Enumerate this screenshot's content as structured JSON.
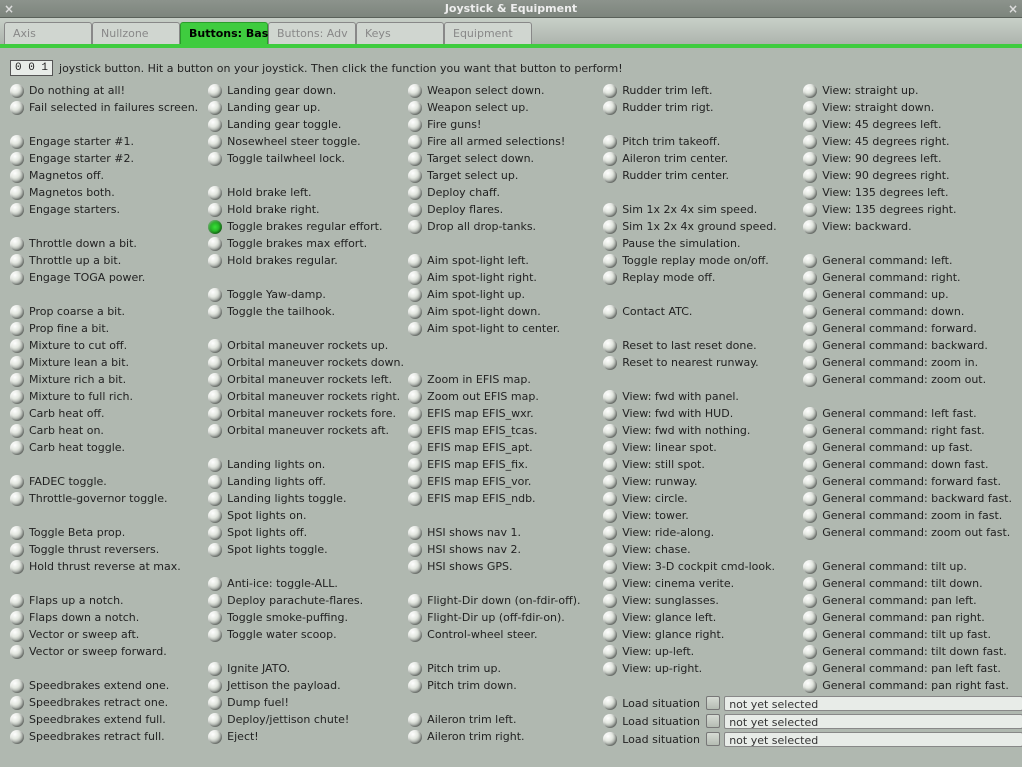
{
  "window": {
    "title": "Joystick & Equipment",
    "close_glyph": "×"
  },
  "tabs": [
    {
      "label": "Axis",
      "active": false
    },
    {
      "label": "Nullzone",
      "active": false
    },
    {
      "label": "Buttons: Basic",
      "active": true
    },
    {
      "label": "Buttons: Adv",
      "active": false
    },
    {
      "label": "Keys",
      "active": false
    },
    {
      "label": "Equipment",
      "active": false
    }
  ],
  "hint": {
    "value": "0 0 1",
    "text": "joystick button. Hit a button on your joystick. Then click the function you want that button to perform!"
  },
  "columns": [
    [
      {
        "t": "opt",
        "label": "Do nothing at all!"
      },
      {
        "t": "opt",
        "label": "Fail selected in failures screen."
      },
      {
        "t": "spacer"
      },
      {
        "t": "opt",
        "label": "Engage starter #1."
      },
      {
        "t": "opt",
        "label": "Engage starter #2."
      },
      {
        "t": "opt",
        "label": "Magnetos off."
      },
      {
        "t": "opt",
        "label": "Magnetos both."
      },
      {
        "t": "opt",
        "label": "Engage starters."
      },
      {
        "t": "spacer"
      },
      {
        "t": "opt",
        "label": "Throttle down a bit."
      },
      {
        "t": "opt",
        "label": "Throttle up a bit."
      },
      {
        "t": "opt",
        "label": "Engage TOGA power."
      },
      {
        "t": "spacer"
      },
      {
        "t": "opt",
        "label": "Prop coarse a bit."
      },
      {
        "t": "opt",
        "label": "Prop fine a bit."
      },
      {
        "t": "opt",
        "label": "Mixture to cut off."
      },
      {
        "t": "opt",
        "label": "Mixture lean a bit."
      },
      {
        "t": "opt",
        "label": "Mixture rich a bit."
      },
      {
        "t": "opt",
        "label": "Mixture to full rich."
      },
      {
        "t": "opt",
        "label": "Carb heat off."
      },
      {
        "t": "opt",
        "label": "Carb heat on."
      },
      {
        "t": "opt",
        "label": "Carb heat toggle."
      },
      {
        "t": "spacer"
      },
      {
        "t": "opt",
        "label": "FADEC toggle."
      },
      {
        "t": "opt",
        "label": "Throttle-governor toggle."
      },
      {
        "t": "spacer"
      },
      {
        "t": "opt",
        "label": "Toggle Beta prop."
      },
      {
        "t": "opt",
        "label": "Toggle thrust reversers."
      },
      {
        "t": "opt",
        "label": "Hold thrust reverse at max."
      },
      {
        "t": "spacer"
      },
      {
        "t": "opt",
        "label": "Flaps up a notch."
      },
      {
        "t": "opt",
        "label": "Flaps down a notch."
      },
      {
        "t": "opt",
        "label": "Vector or sweep aft."
      },
      {
        "t": "opt",
        "label": "Vector or sweep forward."
      },
      {
        "t": "spacer"
      },
      {
        "t": "opt",
        "label": "Speedbrakes extend one."
      },
      {
        "t": "opt",
        "label": "Speedbrakes retract one."
      },
      {
        "t": "opt",
        "label": "Speedbrakes extend full."
      },
      {
        "t": "opt",
        "label": "Speedbrakes retract full."
      }
    ],
    [
      {
        "t": "opt",
        "label": "Landing gear down."
      },
      {
        "t": "opt",
        "label": "Landing gear up."
      },
      {
        "t": "opt",
        "label": "Landing gear toggle."
      },
      {
        "t": "opt",
        "label": "Nosewheel steer toggle."
      },
      {
        "t": "opt",
        "label": "Toggle tailwheel lock."
      },
      {
        "t": "spacer"
      },
      {
        "t": "opt",
        "label": "Hold brake left."
      },
      {
        "t": "opt",
        "label": "Hold brake right."
      },
      {
        "t": "opt",
        "label": "Toggle brakes regular effort.",
        "checked": true
      },
      {
        "t": "opt",
        "label": "Toggle brakes max effort."
      },
      {
        "t": "opt",
        "label": "Hold brakes regular."
      },
      {
        "t": "spacer"
      },
      {
        "t": "opt",
        "label": "Toggle Yaw-damp."
      },
      {
        "t": "opt",
        "label": "Toggle the tailhook."
      },
      {
        "t": "spacer"
      },
      {
        "t": "opt",
        "label": "Orbital maneuver rockets up."
      },
      {
        "t": "opt",
        "label": "Orbital maneuver rockets down."
      },
      {
        "t": "opt",
        "label": "Orbital maneuver rockets left."
      },
      {
        "t": "opt",
        "label": "Orbital maneuver rockets right."
      },
      {
        "t": "opt",
        "label": "Orbital maneuver rockets fore."
      },
      {
        "t": "opt",
        "label": "Orbital maneuver rockets aft."
      },
      {
        "t": "spacer"
      },
      {
        "t": "opt",
        "label": "Landing lights on."
      },
      {
        "t": "opt",
        "label": "Landing lights off."
      },
      {
        "t": "opt",
        "label": "Landing lights toggle."
      },
      {
        "t": "opt",
        "label": "Spot lights on."
      },
      {
        "t": "opt",
        "label": "Spot lights off."
      },
      {
        "t": "opt",
        "label": "Spot lights toggle."
      },
      {
        "t": "spacer"
      },
      {
        "t": "opt",
        "label": "Anti-ice: toggle-ALL."
      },
      {
        "t": "opt",
        "label": "Deploy parachute-flares."
      },
      {
        "t": "opt",
        "label": "Toggle smoke-puffing."
      },
      {
        "t": "opt",
        "label": "Toggle water scoop."
      },
      {
        "t": "spacer"
      },
      {
        "t": "opt",
        "label": "Ignite JATO."
      },
      {
        "t": "opt",
        "label": "Jettison the payload."
      },
      {
        "t": "opt",
        "label": "Dump fuel!"
      },
      {
        "t": "opt",
        "label": "Deploy/jettison chute!"
      },
      {
        "t": "opt",
        "label": "Eject!"
      }
    ],
    [
      {
        "t": "opt",
        "label": "Weapon select down."
      },
      {
        "t": "opt",
        "label": "Weapon select up."
      },
      {
        "t": "opt",
        "label": "Fire guns!"
      },
      {
        "t": "opt",
        "label": "Fire all armed selections!"
      },
      {
        "t": "opt",
        "label": "Target select down."
      },
      {
        "t": "opt",
        "label": "Target select up."
      },
      {
        "t": "opt",
        "label": "Deploy chaff."
      },
      {
        "t": "opt",
        "label": "Deploy flares."
      },
      {
        "t": "opt",
        "label": "Drop all drop-tanks."
      },
      {
        "t": "spacer"
      },
      {
        "t": "opt",
        "label": "Aim spot-light left."
      },
      {
        "t": "opt",
        "label": "Aim spot-light right."
      },
      {
        "t": "opt",
        "label": "Aim spot-light up."
      },
      {
        "t": "opt",
        "label": "Aim spot-light down."
      },
      {
        "t": "opt",
        "label": "Aim spot-light to center."
      },
      {
        "t": "spacer"
      },
      {
        "t": "spacer"
      },
      {
        "t": "opt",
        "label": "Zoom in EFIS map."
      },
      {
        "t": "opt",
        "label": "Zoom out EFIS map."
      },
      {
        "t": "opt",
        "label": "EFIS map EFIS_wxr."
      },
      {
        "t": "opt",
        "label": "EFIS map EFIS_tcas."
      },
      {
        "t": "opt",
        "label": "EFIS map EFIS_apt."
      },
      {
        "t": "opt",
        "label": "EFIS map EFIS_fix."
      },
      {
        "t": "opt",
        "label": "EFIS map EFIS_vor."
      },
      {
        "t": "opt",
        "label": "EFIS map EFIS_ndb."
      },
      {
        "t": "spacer"
      },
      {
        "t": "opt",
        "label": "HSI shows nav 1."
      },
      {
        "t": "opt",
        "label": "HSI shows nav 2."
      },
      {
        "t": "opt",
        "label": "HSI shows GPS."
      },
      {
        "t": "spacer"
      },
      {
        "t": "opt",
        "label": "Flight-Dir down (on-fdir-off)."
      },
      {
        "t": "opt",
        "label": "Flight-Dir up (off-fdir-on)."
      },
      {
        "t": "opt",
        "label": "Control-wheel steer."
      },
      {
        "t": "spacer"
      },
      {
        "t": "opt",
        "label": "Pitch trim up."
      },
      {
        "t": "opt",
        "label": "Pitch trim down."
      },
      {
        "t": "spacer"
      },
      {
        "t": "opt",
        "label": "Aileron trim left."
      },
      {
        "t": "opt",
        "label": "Aileron trim right."
      }
    ],
    [
      {
        "t": "opt",
        "label": "Rudder trim left."
      },
      {
        "t": "opt",
        "label": "Rudder trim rigt."
      },
      {
        "t": "spacer"
      },
      {
        "t": "opt",
        "label": "Pitch trim takeoff."
      },
      {
        "t": "opt",
        "label": "Aileron trim center."
      },
      {
        "t": "opt",
        "label": "Rudder trim center."
      },
      {
        "t": "spacer"
      },
      {
        "t": "opt",
        "label": "Sim 1x 2x 4x sim speed."
      },
      {
        "t": "opt",
        "label": "Sim 1x 2x 4x ground speed."
      },
      {
        "t": "opt",
        "label": "Pause the simulation."
      },
      {
        "t": "opt",
        "label": "Toggle replay mode on/off."
      },
      {
        "t": "opt",
        "label": "Replay mode off."
      },
      {
        "t": "spacer"
      },
      {
        "t": "opt",
        "label": "Contact ATC."
      },
      {
        "t": "spacer"
      },
      {
        "t": "opt",
        "label": "Reset to last reset done."
      },
      {
        "t": "opt",
        "label": "Reset to nearest runway."
      },
      {
        "t": "spacer"
      },
      {
        "t": "opt",
        "label": "View: fwd with panel."
      },
      {
        "t": "opt",
        "label": "View: fwd with HUD."
      },
      {
        "t": "opt",
        "label": "View: fwd with nothing."
      },
      {
        "t": "opt",
        "label": "View: linear spot."
      },
      {
        "t": "opt",
        "label": "View: still spot."
      },
      {
        "t": "opt",
        "label": "View: runway."
      },
      {
        "t": "opt",
        "label": "View: circle."
      },
      {
        "t": "opt",
        "label": "View: tower."
      },
      {
        "t": "opt",
        "label": "View: ride-along."
      },
      {
        "t": "opt",
        "label": "View: chase."
      },
      {
        "t": "opt",
        "label": "View: 3-D cockpit cmd-look."
      },
      {
        "t": "opt",
        "label": "View: cinema verite."
      },
      {
        "t": "opt",
        "label": "View: sunglasses."
      },
      {
        "t": "opt",
        "label": "View: glance left."
      },
      {
        "t": "opt",
        "label": "View: glance right."
      },
      {
        "t": "opt",
        "label": "View: up-left."
      },
      {
        "t": "opt",
        "label": "View: up-right."
      },
      {
        "t": "spacer"
      }
    ],
    [
      {
        "t": "opt",
        "label": "View: straight up."
      },
      {
        "t": "opt",
        "label": "View: straight down."
      },
      {
        "t": "opt",
        "label": "View: 45 degrees left."
      },
      {
        "t": "opt",
        "label": "View: 45 degrees right."
      },
      {
        "t": "opt",
        "label": "View: 90 degrees left."
      },
      {
        "t": "opt",
        "label": "View: 90 degrees right."
      },
      {
        "t": "opt",
        "label": "View: 135 degrees left."
      },
      {
        "t": "opt",
        "label": "View: 135 degrees right."
      },
      {
        "t": "opt",
        "label": "View: backward."
      },
      {
        "t": "spacer"
      },
      {
        "t": "opt",
        "label": "General command: left."
      },
      {
        "t": "opt",
        "label": "General command: right."
      },
      {
        "t": "opt",
        "label": "General command: up."
      },
      {
        "t": "opt",
        "label": "General command: down."
      },
      {
        "t": "opt",
        "label": "General command: forward."
      },
      {
        "t": "opt",
        "label": "General command: backward."
      },
      {
        "t": "opt",
        "label": "General command: zoom in."
      },
      {
        "t": "opt",
        "label": "General command: zoom out."
      },
      {
        "t": "spacer"
      },
      {
        "t": "opt",
        "label": "General command: left fast."
      },
      {
        "t": "opt",
        "label": "General command: right fast."
      },
      {
        "t": "opt",
        "label": "General command: up fast."
      },
      {
        "t": "opt",
        "label": "General command: down fast."
      },
      {
        "t": "opt",
        "label": "General command: forward fast."
      },
      {
        "t": "opt",
        "label": "General command: backward fast."
      },
      {
        "t": "opt",
        "label": "General command: zoom in fast."
      },
      {
        "t": "opt",
        "label": "General command: zoom out fast."
      },
      {
        "t": "spacer"
      },
      {
        "t": "opt",
        "label": "General command: tilt up."
      },
      {
        "t": "opt",
        "label": "General command: tilt down."
      },
      {
        "t": "opt",
        "label": "General command: pan left."
      },
      {
        "t": "opt",
        "label": "General command: pan right."
      },
      {
        "t": "opt",
        "label": "General command: tilt up fast."
      },
      {
        "t": "opt",
        "label": "General command: tilt down fast."
      },
      {
        "t": "opt",
        "label": "General command: pan left fast."
      },
      {
        "t": "opt",
        "label": "General command: pan right fast."
      }
    ]
  ],
  "load_rows": [
    {
      "label": "Load situation",
      "value": "not yet selected"
    },
    {
      "label": "Load situation",
      "value": "not yet selected"
    },
    {
      "label": "Load situation",
      "value": "not yet selected"
    }
  ]
}
